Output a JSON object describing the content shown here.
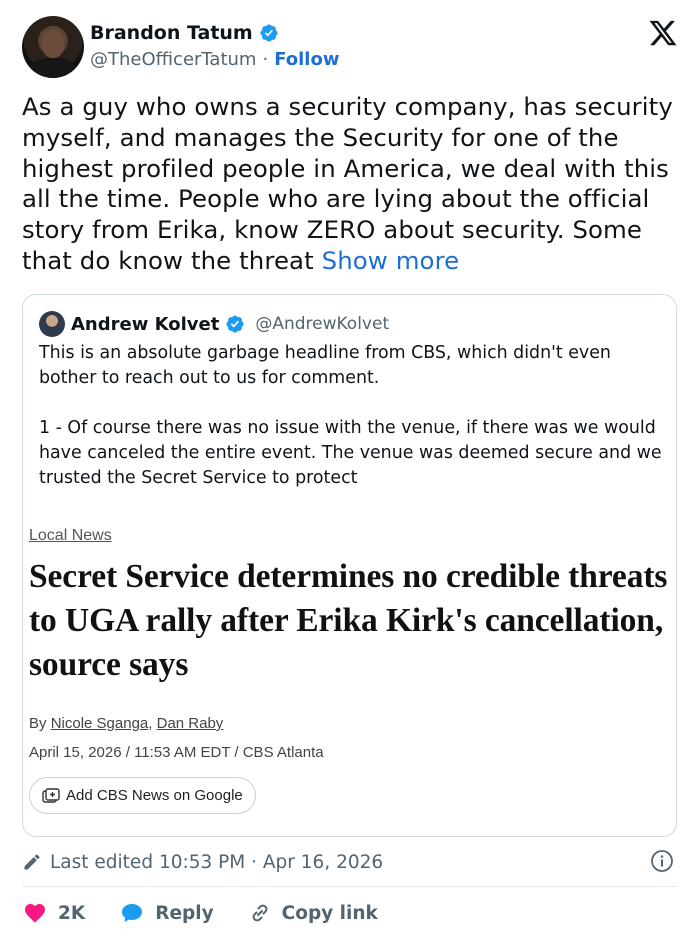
{
  "author": {
    "name": "Brandon Tatum",
    "handle": "@TheOfficerTatum",
    "separator": "·",
    "follow_label": "Follow"
  },
  "tweet": {
    "text": "As a guy who owns a security company, has security myself, and manages the Security for one of the highest profiled people in America, we deal with this all the time. People who are lying about the official story from Erika, know ZERO about security. Some that do know the threat",
    "show_more_label": "Show more"
  },
  "quote": {
    "name": "Andrew Kolvet",
    "handle": "@AndrewKolvet",
    "paragraphs": [
      "This is an absolute garbage headline from CBS, which didn't even bother to reach out to us for comment.",
      "1 - Of course there was no issue with the venue, if there was we would have canceled the entire event. The venue was deemed secure and we trusted the Secret Service to protect"
    ],
    "article": {
      "section": "Local News",
      "headline": "Secret Service determines no credible threats to UGA rally after Erika Kirk's cancellation, source says",
      "by_prefix": "By",
      "authors": [
        "Nicole Sganga",
        "Dan Raby"
      ],
      "dateline": "April 15, 2026 / 11:53 AM EDT / CBS Atlanta",
      "google_button": "Add CBS News on Google"
    }
  },
  "footer": {
    "edited_text": "Last edited 10:53 PM · Apr 16, 2026",
    "likes": "2K",
    "reply_label": "Reply",
    "copy_link_label": "Copy link"
  },
  "colors": {
    "accent": "#1d6fd6",
    "like": "#f91880",
    "verified": "#1d9bf0",
    "muted": "#536471"
  },
  "icons": [
    "verified-badge-icon",
    "x-logo-icon",
    "pencil-icon",
    "info-icon",
    "heart-icon",
    "reply-bubble-icon",
    "link-icon",
    "google-add-icon"
  ]
}
